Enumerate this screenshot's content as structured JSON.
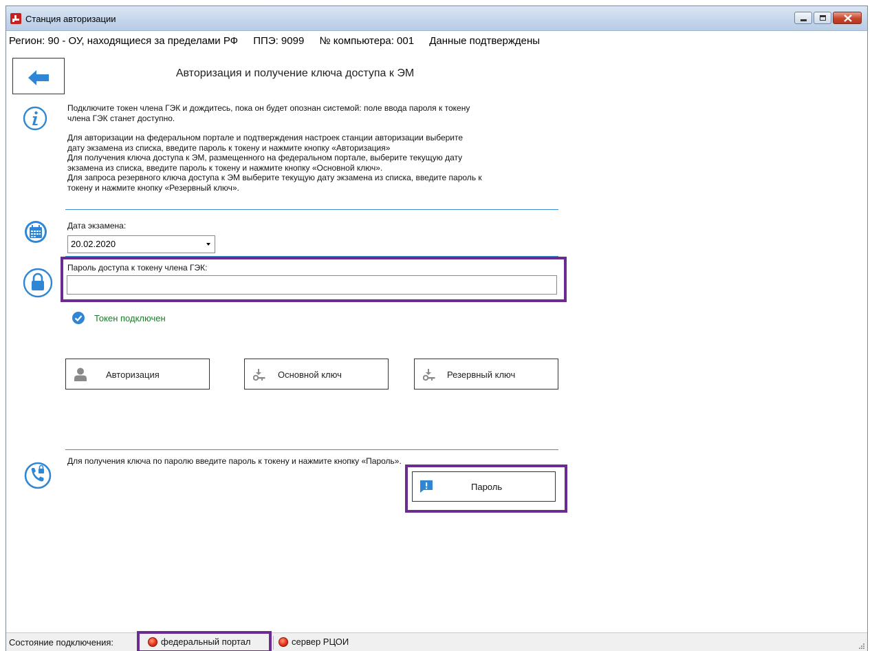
{
  "window": {
    "title": "Станция авторизации",
    "buttons": [
      "minimize",
      "maximize",
      "close"
    ]
  },
  "infobar": {
    "region": "Регион: 90 - ОУ, находящиеся за пределами РФ",
    "ppe": "ППЭ: 9099",
    "computer": "№ компьютера: 001",
    "status": "Данные подтверждены"
  },
  "page": {
    "title": "Авторизация и получение ключа доступа к ЭМ",
    "info_line1": "Подключите токен члена ГЭК и дождитесь, пока он будет опознан системой: поле ввода пароля к токену",
    "info_line2": "члена ГЭК станет доступно.",
    "info_line3": "Для авторизации на федеральном портале и подтверждения настроек станции авторизации выберите",
    "info_line4": "дату экзамена из списка, введите пароль к токену и нажмите кнопку «Авторизация»",
    "info_line5": "Для получения ключа доступа к ЭМ, размещенного на федеральном портале, выберите текущую дату",
    "info_line6": "экзамена из списка, введите пароль к токену и нажмите кнопку «Основной ключ».",
    "info_line7": "Для запроса резервного ключа доступа к ЭМ выберите текущую дату экзамена из списка, введите пароль к",
    "info_line8": "токену и нажмите кнопку «Резервный ключ»."
  },
  "exam_date": {
    "label": "Дата экзамена:",
    "selected": "20.02.2020"
  },
  "password": {
    "label": "Пароль доступа к токену члена ГЭК:",
    "value": ""
  },
  "token_status": "Токен подключен",
  "actions": {
    "auth": "Авторизация",
    "main_key": "Основной ключ",
    "reserve_key": "Резервный ключ"
  },
  "password_key": {
    "hint": "Для получения ключа по паролю введите пароль к токену и нажмите кнопку «Пароль».",
    "button": "Пароль"
  },
  "statusbar": {
    "label": "Состояние подключения:",
    "federal": "федеральный портал",
    "rcoi": "сервер РЦОИ"
  },
  "colors": {
    "accent_blue": "#2e86d4",
    "highlight_purple": "#6a2c91",
    "ok_green": "#1d7a2a",
    "error_red": "#e8321a"
  }
}
